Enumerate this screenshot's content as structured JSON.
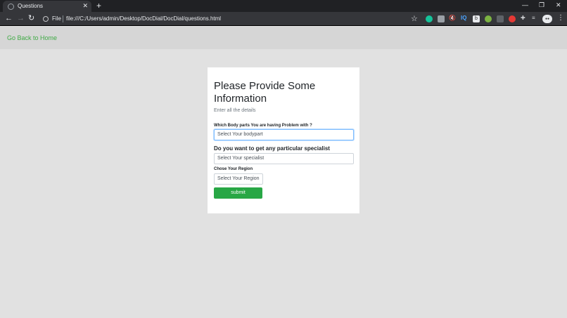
{
  "browser": {
    "tab_title": "Questions",
    "new_tab": "+",
    "close_tab": "✕",
    "scheme_label": "File",
    "url": "file:///C:/Users/admin/Desktop/DocDial/DocDial/questions.html",
    "window_controls": {
      "minimize": "—",
      "restore": "❐",
      "close": "✕"
    },
    "nav": {
      "back": "←",
      "forward": "→",
      "reload": "↻"
    },
    "star": "☆",
    "menu": "⋮",
    "extensions": [
      "grammarly-icon",
      "save-icon",
      "mute-icon",
      "iq-icon",
      "b-icon",
      "green-circle-icon",
      "chart-icon",
      "red-drop-icon",
      "puzzle-icon",
      "playlist-icon"
    ],
    "extension_glyphs": {
      "mute": "🔇",
      "iq": "IQ",
      "b": "b",
      "puzzle": "✚",
      "playlist": "≡"
    }
  },
  "page": {
    "home_link": "Go Back to Home",
    "form": {
      "title": "Please Provide Some Information",
      "subtitle": "Enter all the details",
      "body_part_label": "Which Body parts You are having Problem with ?",
      "body_part_placeholder": "Select Your bodypart",
      "specialist_label": "Do you want to get any particular specialist",
      "specialist_placeholder": "Select Your specialist",
      "region_label": "Chose Your Region",
      "region_placeholder": "Select Your Region",
      "submit_label": "submit"
    }
  },
  "colors": {
    "accent_green": "#28a745",
    "link_green": "#3faa45",
    "page_bg": "#e1e1e1",
    "focus_border": "#80bdff"
  }
}
